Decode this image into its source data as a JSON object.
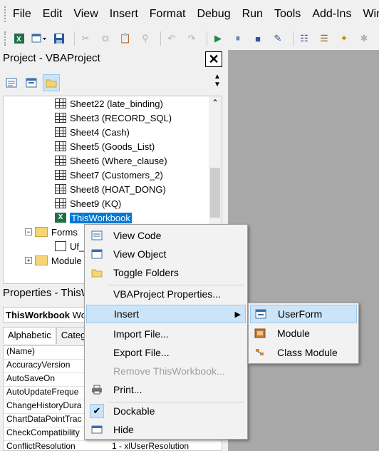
{
  "menubar": {
    "items": [
      "File",
      "Edit",
      "View",
      "Insert",
      "Format",
      "Debug",
      "Run",
      "Tools",
      "Add-Ins",
      "Windo"
    ]
  },
  "toolbar": {
    "icons": [
      "excel-icon",
      "insert-userform-icon",
      "save-icon",
      "cut-icon",
      "copy-icon",
      "paste-icon",
      "find-icon",
      "undo-icon",
      "redo-icon",
      "run-icon",
      "break-icon",
      "reset-icon",
      "design-mode-icon",
      "project-explorer-icon",
      "properties-icon",
      "object-browser-icon",
      "toolbox-icon"
    ]
  },
  "project_panel": {
    "title": "Project - VBAProject",
    "close": "✕",
    "tree": [
      {
        "label": "Sheet22 (late_binding)",
        "type": "sheet"
      },
      {
        "label": "Sheet3 (RECORD_SQL)",
        "type": "sheet"
      },
      {
        "label": "Sheet4 (Cash)",
        "type": "sheet"
      },
      {
        "label": "Sheet5 (Goods_List)",
        "type": "sheet"
      },
      {
        "label": "Sheet6 (Where_clause)",
        "type": "sheet"
      },
      {
        "label": "Sheet7 (Customers_2)",
        "type": "sheet"
      },
      {
        "label": "Sheet8 (HOAT_DONG)",
        "type": "sheet"
      },
      {
        "label": "Sheet9 (KQ)",
        "type": "sheet"
      },
      {
        "label": "ThisWorkbook",
        "type": "workbook",
        "selected": true
      },
      {
        "label": "Forms",
        "type": "folder",
        "expander": "−"
      },
      {
        "label": "Uf_",
        "type": "form"
      },
      {
        "label": "Module",
        "type": "folder",
        "expander": "+"
      }
    ]
  },
  "properties_panel": {
    "title": "Properties - ThisW",
    "object_name": "ThisWorkbook",
    "object_type": "Wo",
    "tabs": [
      "Alphabetic",
      "Catego"
    ],
    "rows": [
      {
        "name": "(Name)",
        "value": ""
      },
      {
        "name": "AccuracyVersion",
        "value": ""
      },
      {
        "name": "AutoSaveOn",
        "value": ""
      },
      {
        "name": "AutoUpdateFreque",
        "value": ""
      },
      {
        "name": "ChangeHistoryDura",
        "value": ""
      },
      {
        "name": "ChartDataPointTrac",
        "value": ""
      },
      {
        "name": "CheckCompatibility",
        "value": ""
      },
      {
        "name": "ConflictResolution",
        "value": "1 - xlUserResolution"
      }
    ]
  },
  "context_menu": {
    "items": [
      {
        "label": "View Code",
        "icon": "view-code-icon"
      },
      {
        "label": "View Object",
        "icon": "view-object-icon"
      },
      {
        "label": "Toggle Folders",
        "icon": "folder-icon"
      },
      {
        "label": "VBAProject Properties..."
      },
      {
        "label": "Insert",
        "highlighted": true,
        "submenu": true
      },
      {
        "label": "Import File..."
      },
      {
        "label": "Export File..."
      },
      {
        "label": "Remove ThisWorkbook...",
        "disabled": true
      },
      {
        "label": "Print...",
        "icon": "print-icon"
      },
      {
        "label": "Dockable",
        "checked": true
      },
      {
        "label": "Hide",
        "icon": "hide-icon"
      }
    ]
  },
  "insert_submenu": {
    "items": [
      {
        "label": "UserForm",
        "icon": "userform-icon",
        "highlighted": true
      },
      {
        "label": "Module",
        "icon": "module-icon"
      },
      {
        "label": "Class Module",
        "icon": "class-module-icon"
      }
    ]
  },
  "colors": {
    "selection": "#0078d7",
    "highlight": "#cce4f7",
    "workspace": "#a8a8a8"
  }
}
